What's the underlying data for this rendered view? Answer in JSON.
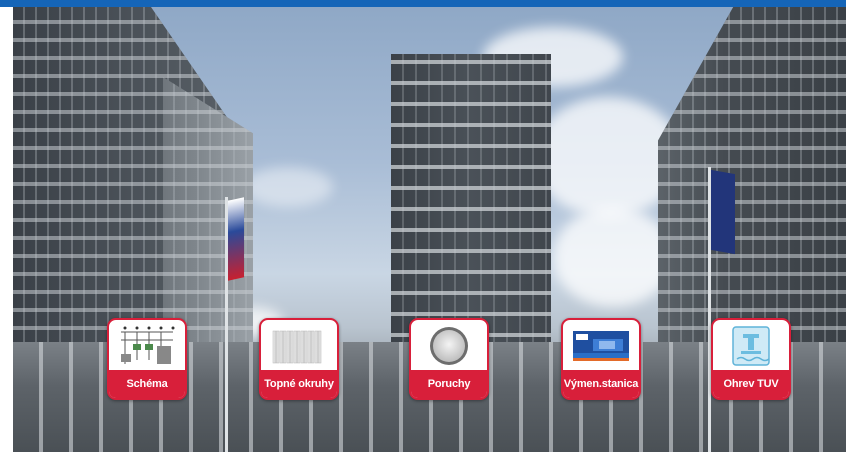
{
  "colors": {
    "accent_red": "#d81f3a",
    "top_bar_blue": "#1565b8",
    "tile_label_text": "#ffffff"
  },
  "background": {
    "subject": "office-towers-photo"
  },
  "tiles": [
    {
      "label": "Schéma",
      "icon": "schema-diagram-icon"
    },
    {
      "label": "Topné okruhy",
      "icon": "radiator-icon"
    },
    {
      "label": "Poruchy",
      "icon": "fault-indicator-icon"
    },
    {
      "label": "Výmen.stanica",
      "icon": "exchange-station-icon"
    },
    {
      "label": "Ohrev TUV",
      "icon": "hot-water-tank-icon"
    }
  ]
}
